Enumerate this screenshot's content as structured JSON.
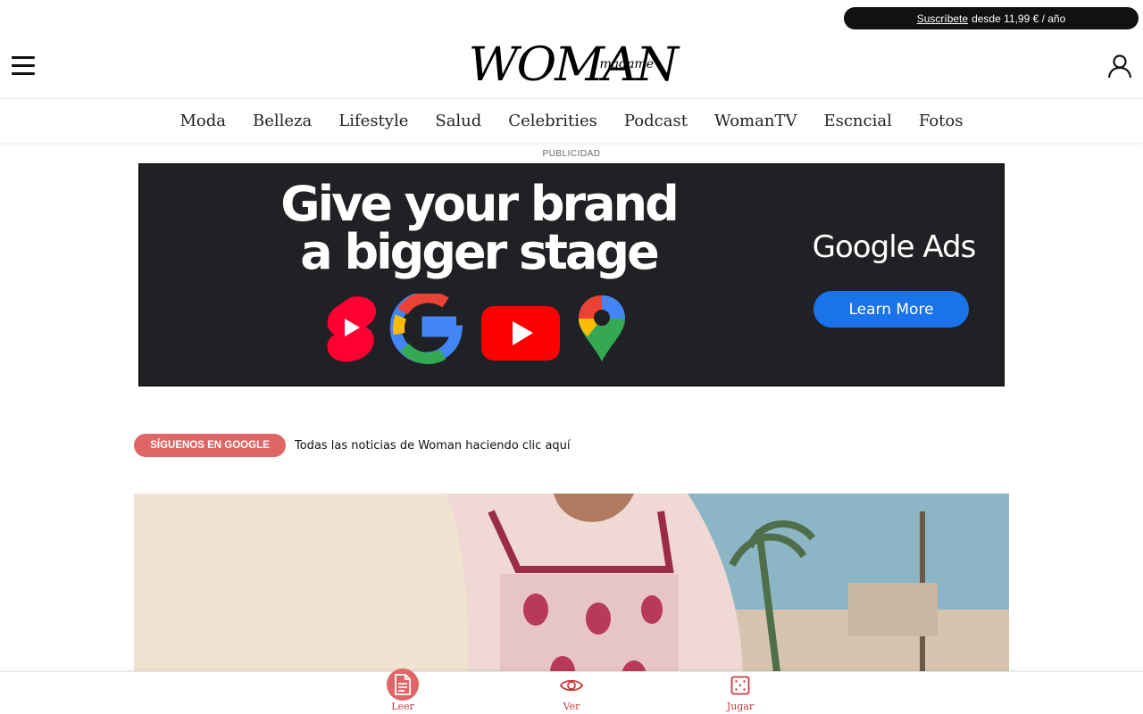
{
  "topbar": {
    "subscribe_link": "Suscríbete",
    "subscribe_text": "desde 11,99 € / año"
  },
  "header": {
    "logo_main": "WOMAN",
    "logo_sub": "madame",
    "menu_icon": "hamburger-menu-icon",
    "user_icon": "user-account-icon"
  },
  "nav": {
    "items": [
      {
        "label": "Moda"
      },
      {
        "label": "Belleza"
      },
      {
        "label": "Lifestyle"
      },
      {
        "label": "Salud"
      },
      {
        "label": "Celebrities"
      },
      {
        "label": "Podcast"
      },
      {
        "label": "WomanTV"
      },
      {
        "label": "Escncial"
      },
      {
        "label": "Fotos"
      }
    ]
  },
  "ad": {
    "label": "PUBLICIDAD",
    "headline_line1": "Give your brand",
    "headline_line2": "a bigger stage",
    "brand": "Google Ads",
    "cta": "Learn More",
    "background_color": "#202124",
    "cta_color": "#1a73e8"
  },
  "follow": {
    "badge": "SÍGUENOS EN GOOGLE",
    "text": "Todas las noticias de Woman haciendo clic aquí",
    "badge_color": "#e06666"
  },
  "bottom_nav": {
    "items": [
      {
        "label": "Leer",
        "icon": "document-icon",
        "active": true
      },
      {
        "label": "Ver",
        "icon": "eye-icon",
        "active": false
      },
      {
        "label": "Jugar",
        "icon": "dice-icon",
        "active": false
      }
    ],
    "accent_color": "#c63c3c"
  }
}
